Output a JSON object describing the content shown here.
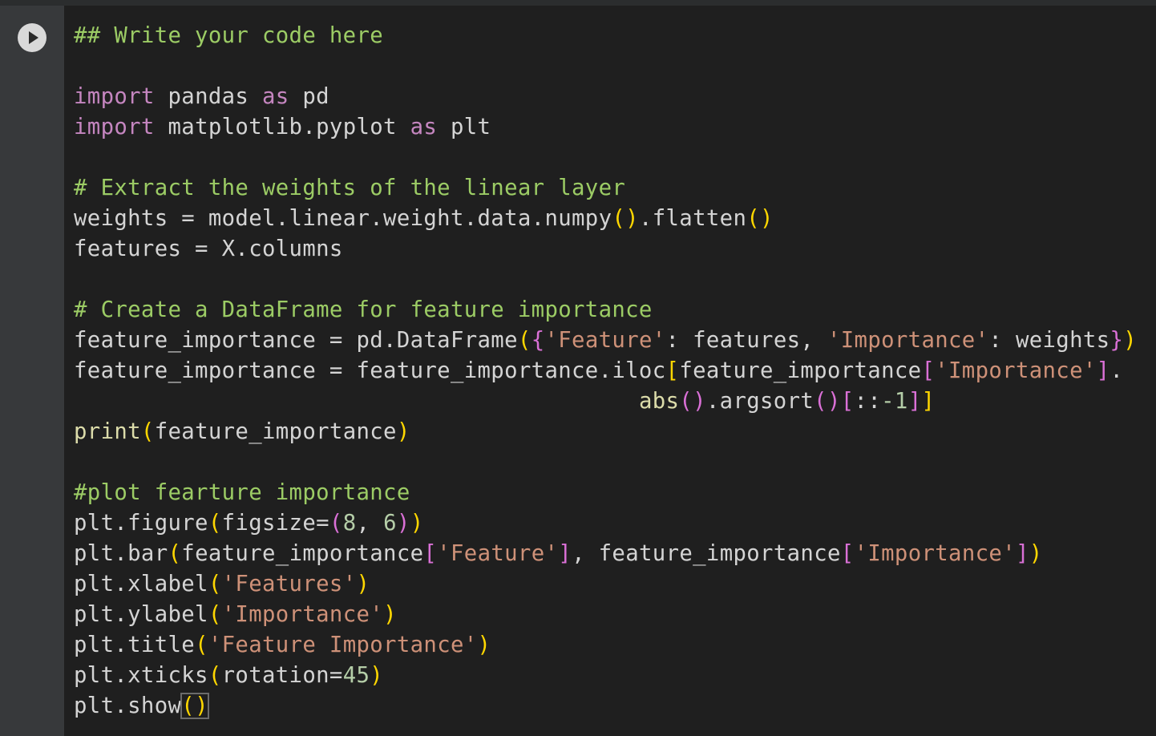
{
  "cell": {
    "run_button_icon": "play-icon",
    "code_lines": [
      [
        [
          "cm",
          "## Write your code here"
        ]
      ],
      [],
      [
        [
          "kw",
          "import"
        ],
        [
          "",
          " pandas "
        ],
        [
          "kw",
          "as"
        ],
        [
          "",
          " pd"
        ]
      ],
      [
        [
          "kw",
          "import"
        ],
        [
          "",
          " matplotlib.pyplot "
        ],
        [
          "kw",
          "as"
        ],
        [
          "",
          " plt"
        ]
      ],
      [],
      [
        [
          "cm",
          "# Extract the weights of the linear layer"
        ]
      ],
      [
        [
          "",
          "weights = model.linear.weight.data.numpy"
        ],
        [
          "p1",
          "()"
        ],
        [
          "",
          ".flatten"
        ],
        [
          "p1",
          "()"
        ]
      ],
      [
        [
          "",
          "features = X.columns"
        ]
      ],
      [],
      [
        [
          "cm",
          "# Create a DataFrame for feature importance"
        ]
      ],
      [
        [
          "",
          "feature_importance = pd.DataFrame"
        ],
        [
          "p1",
          "("
        ],
        [
          "p2",
          "{"
        ],
        [
          "str",
          "'Feature'"
        ],
        [
          "",
          ": features, "
        ],
        [
          "str",
          "'Importance'"
        ],
        [
          "",
          ": weights"
        ],
        [
          "p2",
          "}"
        ],
        [
          "p1",
          ")"
        ]
      ],
      [
        [
          "",
          "feature_importance = feature_importance.iloc"
        ],
        [
          "p1",
          "["
        ],
        [
          "",
          "feature_importance"
        ],
        [
          "p2",
          "["
        ],
        [
          "str",
          "'Importance'"
        ],
        [
          "p2",
          "]"
        ],
        [
          "",
          "."
        ]
      ],
      [
        [
          "",
          "                                          "
        ],
        [
          "fn",
          "abs"
        ],
        [
          "p2",
          "()"
        ],
        [
          "",
          ".argsort"
        ],
        [
          "p2",
          "()"
        ],
        [
          "p2",
          "["
        ],
        [
          "",
          "::"
        ],
        [
          "num",
          "-1"
        ],
        [
          "p2",
          "]"
        ],
        [
          "p1",
          "]"
        ]
      ],
      [
        [
          "fn",
          "print"
        ],
        [
          "p1",
          "("
        ],
        [
          "",
          "feature_importance"
        ],
        [
          "p1",
          ")"
        ]
      ],
      [],
      [
        [
          "cm",
          "#plot fearture importance"
        ]
      ],
      [
        [
          "",
          "plt.figure"
        ],
        [
          "p1",
          "("
        ],
        [
          "",
          "figsize="
        ],
        [
          "p2",
          "("
        ],
        [
          "num",
          "8"
        ],
        [
          "",
          ", "
        ],
        [
          "num",
          "6"
        ],
        [
          "p2",
          ")"
        ],
        [
          "p1",
          ")"
        ]
      ],
      [
        [
          "",
          "plt.bar"
        ],
        [
          "p1",
          "("
        ],
        [
          "",
          "feature_importance"
        ],
        [
          "p2",
          "["
        ],
        [
          "str",
          "'Feature'"
        ],
        [
          "p2",
          "]"
        ],
        [
          "",
          ", feature_importance"
        ],
        [
          "p2",
          "["
        ],
        [
          "str",
          "'Importance'"
        ],
        [
          "p2",
          "]"
        ],
        [
          "p1",
          ")"
        ]
      ],
      [
        [
          "",
          "plt.xlabel"
        ],
        [
          "p1",
          "("
        ],
        [
          "str",
          "'Features'"
        ],
        [
          "p1",
          ")"
        ]
      ],
      [
        [
          "",
          "plt.ylabel"
        ],
        [
          "p1",
          "("
        ],
        [
          "str",
          "'Importance'"
        ],
        [
          "p1",
          ")"
        ]
      ],
      [
        [
          "",
          "plt.title"
        ],
        [
          "p1",
          "("
        ],
        [
          "str",
          "'Feature Importance'"
        ],
        [
          "p1",
          ")"
        ]
      ],
      [
        [
          "",
          "plt.xticks"
        ],
        [
          "p1",
          "("
        ],
        [
          "",
          "rotation="
        ],
        [
          "num",
          "45"
        ],
        [
          "p1",
          ")"
        ]
      ],
      [
        [
          "",
          "plt.show"
        ],
        [
          "p1",
          "()"
        ]
      ]
    ]
  }
}
